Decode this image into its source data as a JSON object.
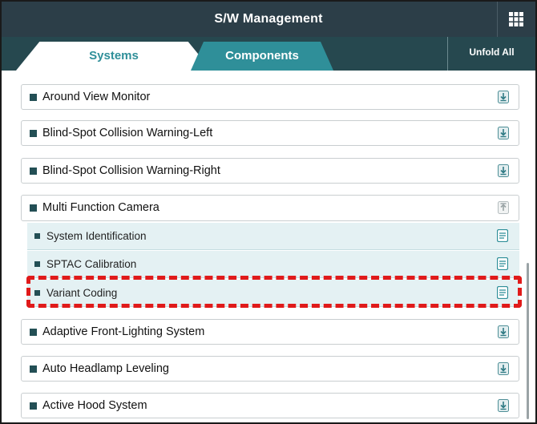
{
  "header": {
    "title": "S/W Management",
    "menu_icon": "grid-icon"
  },
  "tabs": [
    {
      "label": "Systems",
      "active": true
    },
    {
      "label": "Components",
      "active": false
    }
  ],
  "unfold_label": "Unfold All",
  "systems": [
    {
      "label": "Around View Monitor",
      "icon": "download-icon"
    },
    {
      "label": "Blind-Spot Collision Warning-Left",
      "icon": "download-icon"
    },
    {
      "label": "Blind-Spot Collision Warning-Right",
      "icon": "download-icon"
    },
    {
      "label": "Multi Function Camera",
      "icon": "upload-icon"
    }
  ],
  "sub_items": [
    {
      "label": "System Identification",
      "icon": "document-icon"
    },
    {
      "label": "SPTAC Calibration",
      "icon": "document-icon"
    },
    {
      "label": "Variant Coding",
      "icon": "document-icon",
      "highlighted": true
    }
  ],
  "systems_after": [
    {
      "label": "Adaptive Front-Lighting System",
      "icon": "download-icon"
    },
    {
      "label": "Auto Headlamp Leveling",
      "icon": "download-icon"
    },
    {
      "label": "Active Hood System",
      "icon": "download-icon"
    }
  ],
  "colors": {
    "title_bar": "#2c3e48",
    "tab_bar": "#26484f",
    "accent_teal": "#2f8f99",
    "sub_row_bg": "#e4f1f3",
    "highlight": "#e01a1a"
  }
}
